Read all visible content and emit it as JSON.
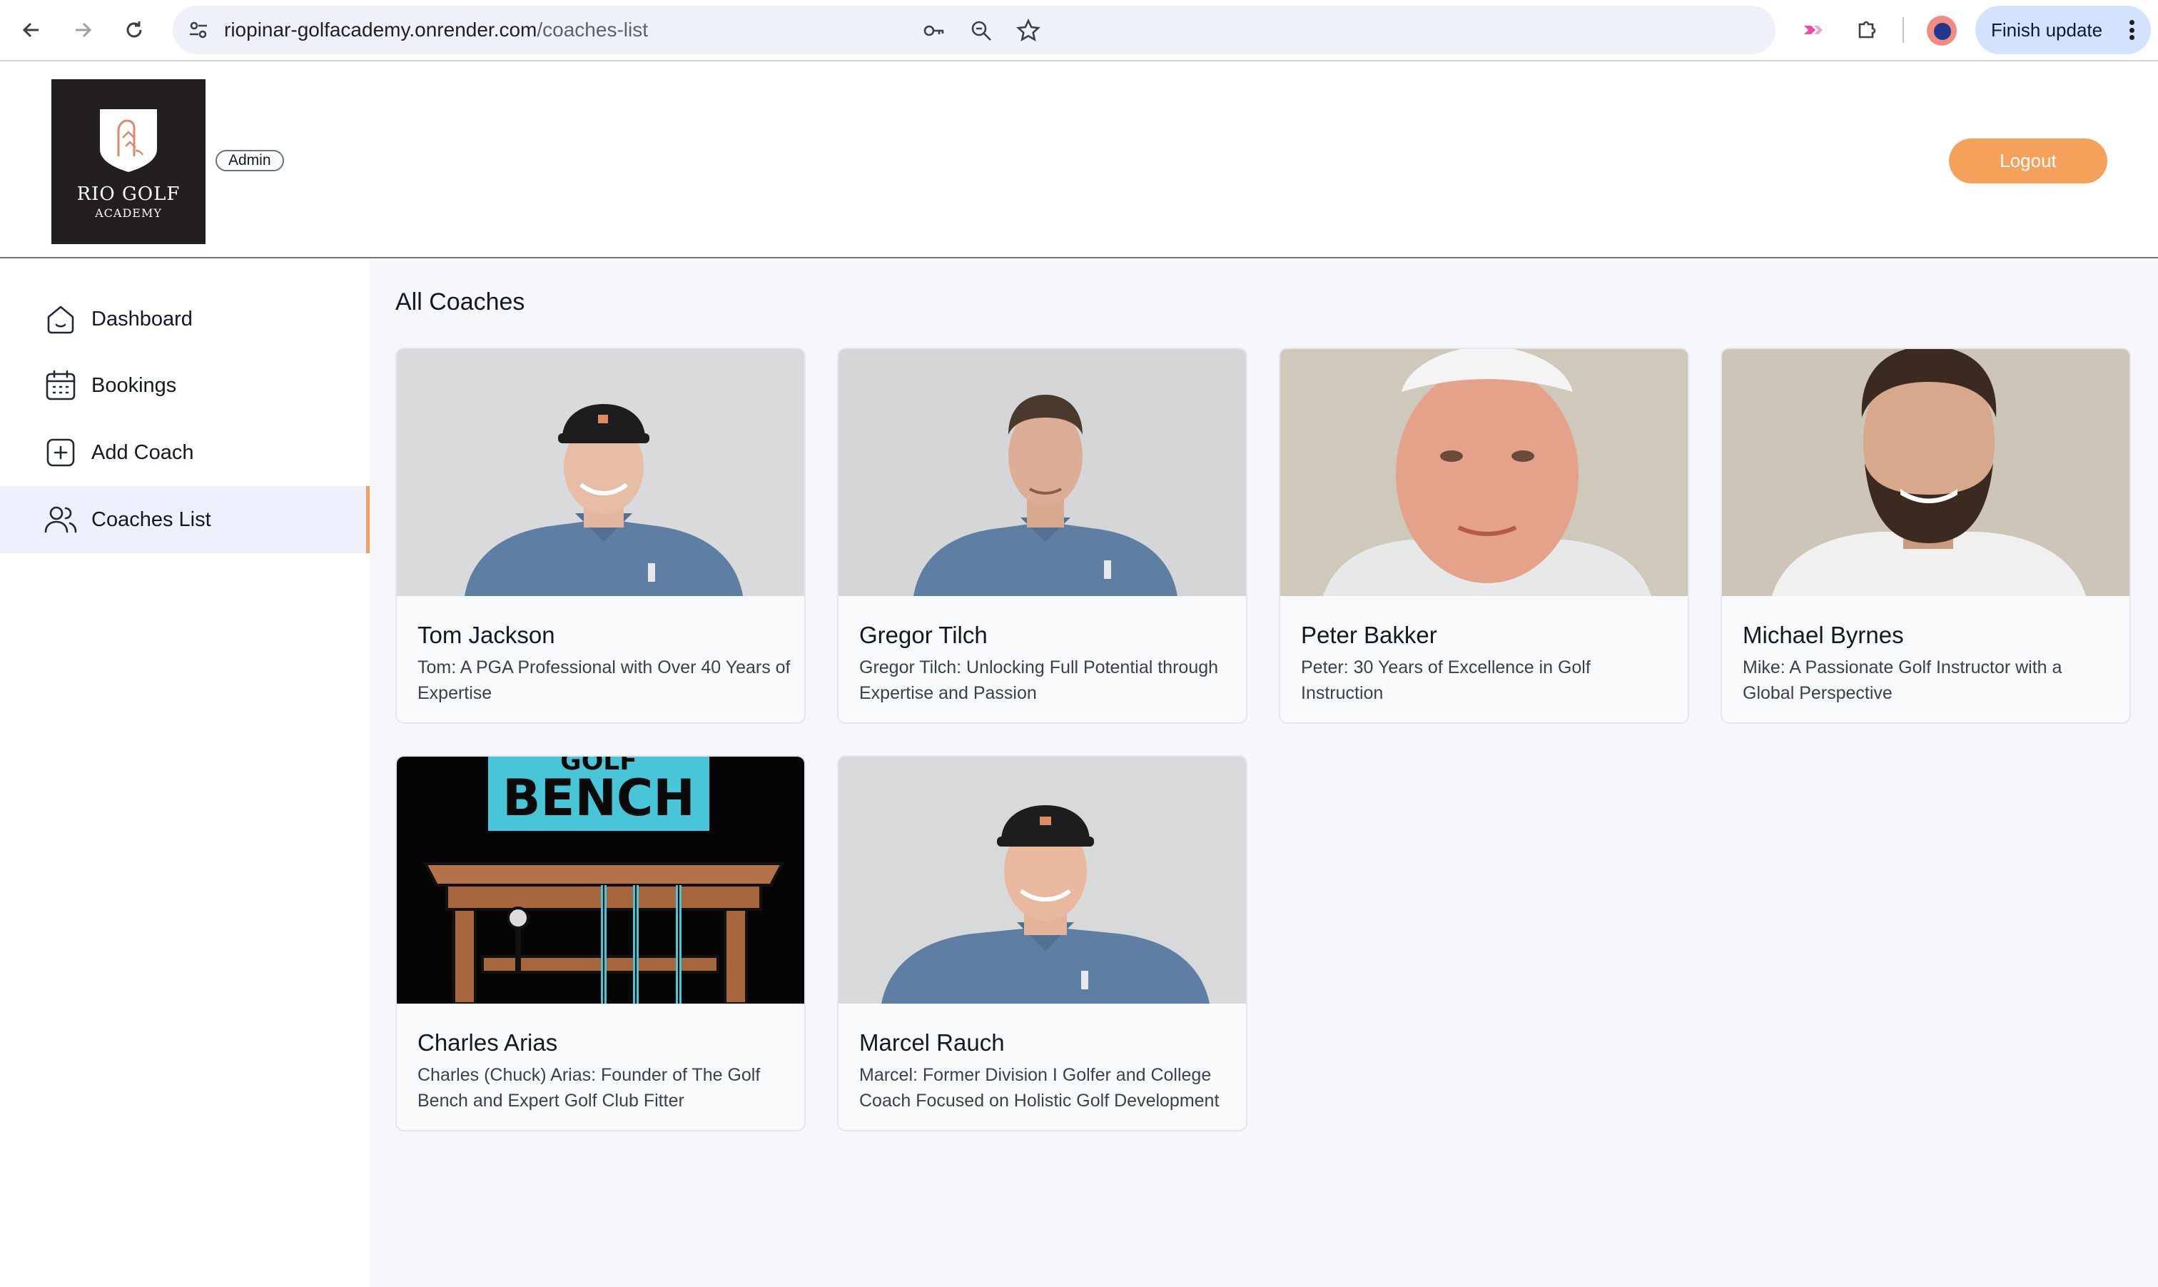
{
  "browser": {
    "url_host": "riopinar-golfacademy.onrender.com",
    "url_path": "/coaches-list",
    "finish_update_label": "Finish update"
  },
  "header": {
    "logo_title": "RIO GOLF",
    "logo_subtitle": "ACADEMY",
    "role_badge": "Admin",
    "logout_label": "Logout",
    "accent_color": "#f4a25b"
  },
  "sidebar": {
    "items": [
      {
        "label": "Dashboard",
        "icon": "home-icon",
        "active": false
      },
      {
        "label": "Bookings",
        "icon": "calendar-icon",
        "active": false
      },
      {
        "label": "Add Coach",
        "icon": "plus-square-icon",
        "active": false
      },
      {
        "label": "Coaches List",
        "icon": "users-icon",
        "active": true
      }
    ]
  },
  "main": {
    "title": "All Coaches",
    "coaches": [
      {
        "name": "Tom Jackson",
        "description": "Tom: A PGA Professional with Over 40 Years of Expertise"
      },
      {
        "name": "Gregor Tilch",
        "description": "Gregor Tilch: Unlocking Full Potential through Expertise and Passion"
      },
      {
        "name": "Peter Bakker",
        "description": "Peter: 30 Years of Excellence in Golf Instruction"
      },
      {
        "name": "Michael Byrnes",
        "description": "Mike: A Passionate Golf Instructor with a Global Perspective"
      },
      {
        "name": "Charles Arias",
        "description": "Charles (Chuck) Arias: Founder of The Golf Bench and Expert Golf Club Fitter"
      },
      {
        "name": "Marcel Rauch",
        "description": "Marcel: Former Division I Golfer and College Coach Focused on Holistic Golf Development"
      }
    ],
    "bench_sign_text": "BENCH",
    "bench_sign_partial": "GOLF"
  }
}
